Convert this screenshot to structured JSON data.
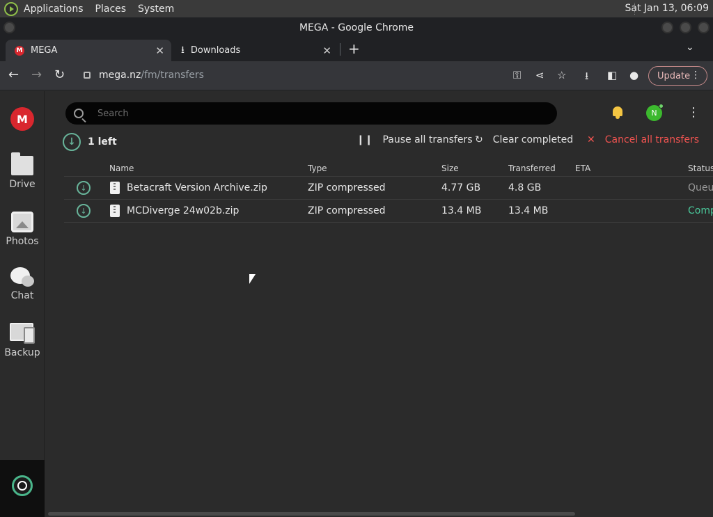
{
  "os_panel": {
    "menus": [
      "Applications",
      "Places",
      "System"
    ],
    "clock": "Sat Jan 13, 06:09"
  },
  "window": {
    "title": "MEGA - Google Chrome"
  },
  "tabs": [
    {
      "label": "MEGA",
      "favicon": "M"
    },
    {
      "label": "Downloads"
    }
  ],
  "toolbar": {
    "url_host": "mega.nz",
    "url_path": "/fm/transfers",
    "update_label": "Update"
  },
  "sidebar": {
    "logo": "M",
    "items": [
      {
        "label": "Drive",
        "icon": "folder-icon"
      },
      {
        "label": "Photos",
        "icon": "photo-icon"
      },
      {
        "label": "Chat",
        "icon": "chat-icon"
      },
      {
        "label": "Backup",
        "icon": "backup-icon"
      }
    ]
  },
  "header": {
    "search_placeholder": "Search",
    "avatar_initial": "N"
  },
  "transfers": {
    "left_label": "1 left",
    "pause_all": "Pause all transfers",
    "clear_completed": "Clear completed",
    "cancel_all": "Cancel all transfers",
    "columns": [
      "Name",
      "Type",
      "Size",
      "Transferred",
      "ETA",
      "Status"
    ],
    "rows": [
      {
        "name": "Betacraft Version Archive.zip",
        "type": "ZIP compressed",
        "size": "4.77 GB",
        "transferred": "4.8 GB",
        "eta": "",
        "status": "Queue"
      },
      {
        "name": "MCDiverge 24w02b.zip",
        "type": "ZIP compressed",
        "size": "13.4 MB",
        "transferred": "13.4 MB",
        "eta": "",
        "status": "Comp"
      }
    ]
  },
  "colors": {
    "mega_red": "#d9272e",
    "complete_green": "#4ac99b",
    "cancel_red": "#ef5350"
  }
}
